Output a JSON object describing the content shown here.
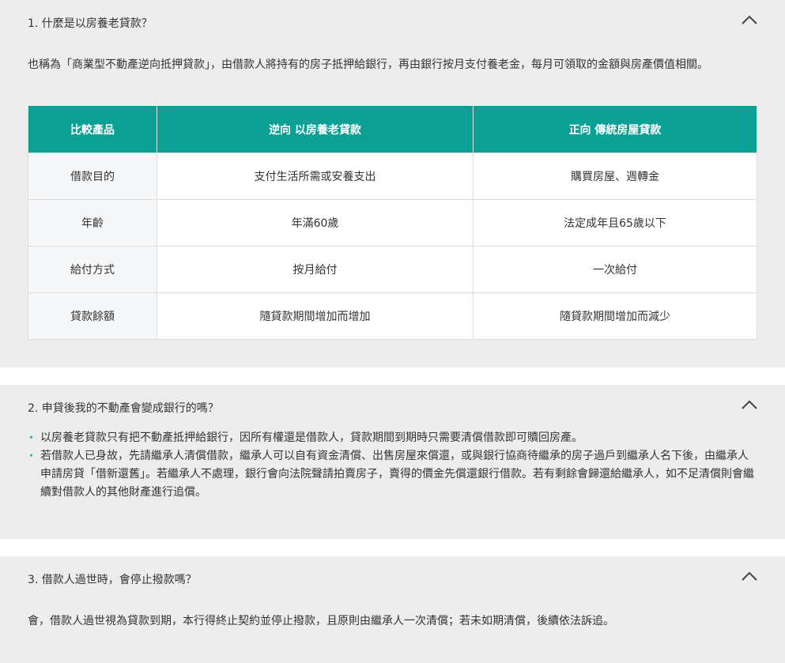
{
  "faq": [
    {
      "question": "1. 什麼是以房養老貸款？",
      "answer": "也稱為「商業型不動產逆向抵押貸款」，由借款人將持有的房子抵押給銀行，再由銀行按月支付養老金，每月可領取的金額與房產價值相關。",
      "table": {
        "headers": [
          "比較產品",
          "逆向 以房養老貸款",
          "正向 傳統房屋貸款"
        ],
        "rows": [
          [
            "借款目的",
            "支付生活所需或安養支出",
            "購買房屋、週轉金"
          ],
          [
            "年齡",
            "年滿60歲",
            "法定成年且65歲以下"
          ],
          [
            "給付方式",
            "按月給付",
            "一次給付"
          ],
          [
            "貸款餘額",
            "隨貸款期間增加而增加",
            "隨貸款期間增加而減少"
          ]
        ]
      }
    },
    {
      "question": "2. 申貸後我的不動產會變成銀行的嗎？",
      "bullets": [
        "以房養老貸款只有把不動產抵押給銀行，因所有權還是借款人，貸款期間到期時只需要清償借款即可贖回房產。",
        "若借款人已身故，先請繼承人清償借款，繼承人可以自有資金清償、出售房屋來償還，或與銀行協商待繼承的房子過戶到繼承人名下後，由繼承人申請房貸「借新還舊」。若繼承人不處理，銀行會向法院聲請拍賣房子，賣得的價金先償還銀行借款。若有剩餘會歸還給繼承人，如不足清償則會繼續對借款人的其他財產進行追償。"
      ]
    },
    {
      "question": "3. 借款人過世時，會停止撥款嗎？",
      "answer": "會，借款人過世視為貸款到期，本行得終止契約並停止撥款，且原則由繼承人一次清償；若未如期清償，後續依法訴追。"
    }
  ],
  "bullet_glyph": "‧",
  "toggle_icon": "chevron-up-icon",
  "colors": {
    "accent": "#0aa094",
    "panel_bg": "#ededed",
    "row_head_bg": "#f5f7f9"
  }
}
